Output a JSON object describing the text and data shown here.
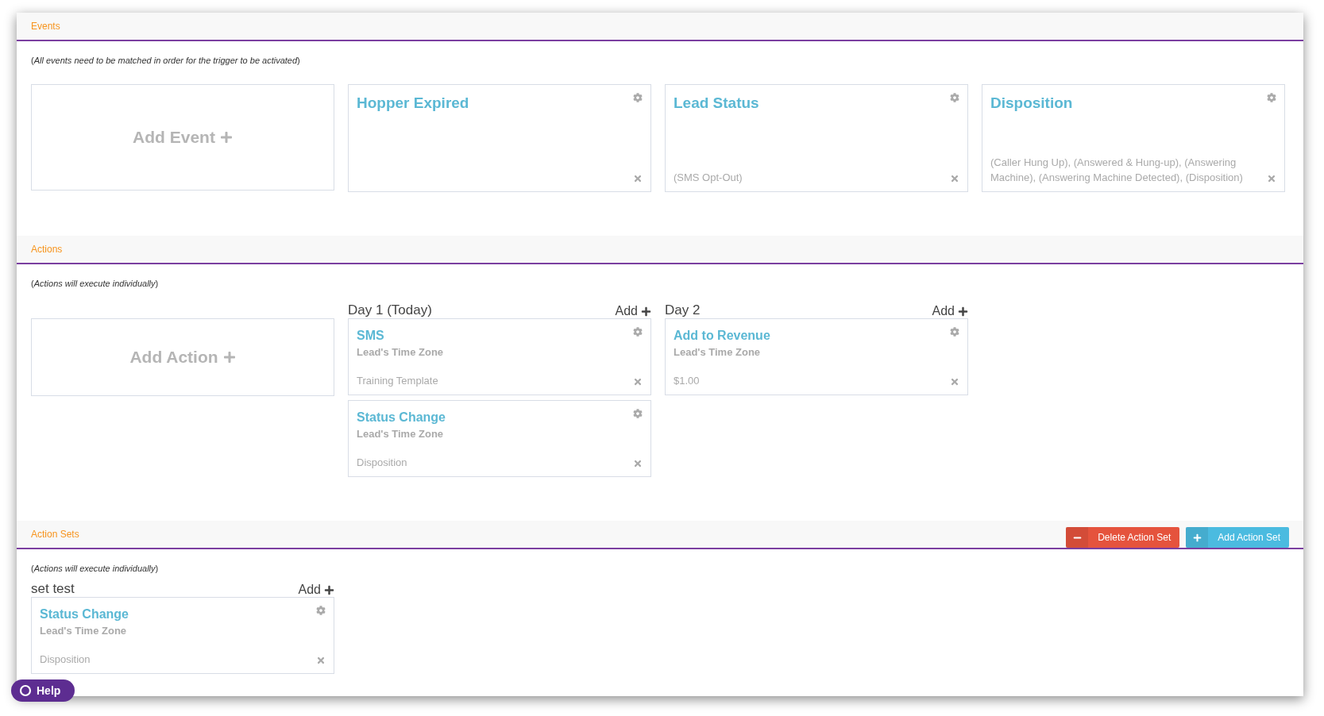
{
  "events": {
    "title": "Events",
    "note": "(*All events need to be matched in order for the trigger to be activated*)",
    "add_label": "Add Event",
    "cards": [
      {
        "title": "Hopper Expired"
      },
      {
        "title": "Lead Status",
        "detail": "(SMS Opt-Out)"
      },
      {
        "title": "Disposition",
        "detail": "(Caller Hung Up), (Answered & Hung-up), (Answering Machine), (Answering Machine Detected), (Disposition)"
      }
    ]
  },
  "actions": {
    "title": "Actions",
    "note": "(*Actions will execute individually*)",
    "add_label": "Add Action",
    "days": [
      {
        "label": "Day 1 (Today)",
        "add_label": "Add",
        "cards": [
          {
            "title": "SMS",
            "subtitle": "Lead's Time Zone",
            "detail": "Training Template"
          },
          {
            "title": "Status Change",
            "subtitle": "Lead's Time Zone",
            "detail": "Disposition"
          }
        ]
      },
      {
        "label": "Day 2",
        "add_label": "Add",
        "cards": [
          {
            "title": "Add to Revenue",
            "subtitle": "Lead's Time Zone",
            "detail": "$1.00"
          }
        ]
      }
    ]
  },
  "action_sets": {
    "title": "Action Sets",
    "buttons": [
      {
        "label": "Delete Action Set",
        "kind": "delete"
      },
      {
        "label": "Add Action Set",
        "kind": "add"
      }
    ],
    "note": "(*Actions will execute individually*)",
    "sets": [
      {
        "label": "set test",
        "add_label": "Add",
        "cards": [
          {
            "title": "Status Change",
            "subtitle": "Lead's Time Zone",
            "detail": "Disposition"
          }
        ]
      }
    ]
  },
  "help": {
    "label": "Help"
  }
}
